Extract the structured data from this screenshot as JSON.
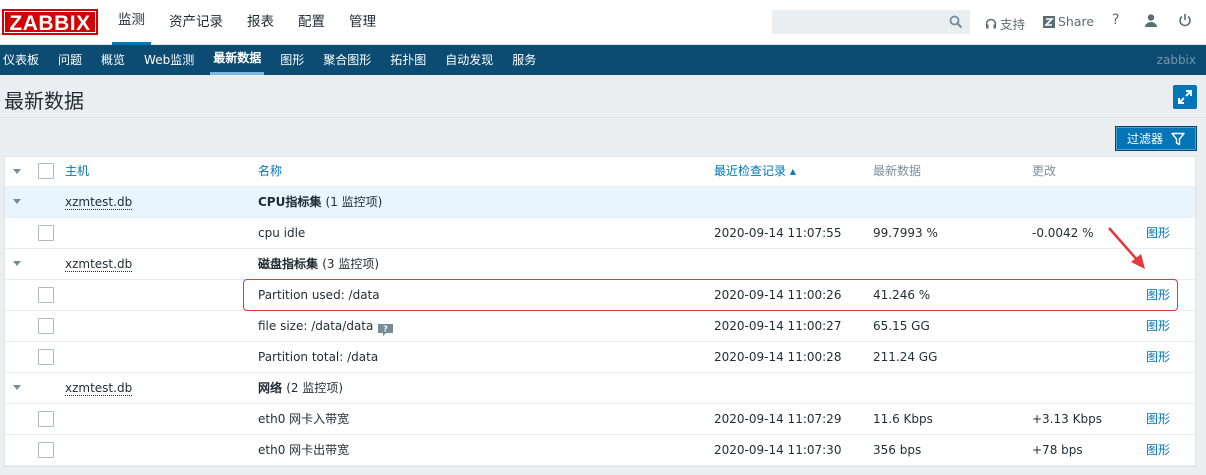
{
  "logo": "ZABBIX",
  "top_menu": [
    "监测",
    "资产记录",
    "报表",
    "配置",
    "管理"
  ],
  "top_menu_active": 0,
  "search": {
    "value": "",
    "placeholder": ""
  },
  "top_links": {
    "support": "支持",
    "share": "Share",
    "help": "?"
  },
  "sub_menu": [
    "仪表板",
    "问题",
    "概览",
    "Web监测",
    "最新数据",
    "图形",
    "聚合图形",
    "拓扑图",
    "自动发现",
    "服务"
  ],
  "sub_menu_active": 4,
  "user": "zabbix",
  "page_title": "最新数据",
  "filter_button": "过滤器",
  "table": {
    "headers": {
      "host": "主机",
      "name": "名称",
      "last_check": "最近检查记录 ▴",
      "last_value": "最新数据",
      "change": "更改"
    },
    "groups": [
      {
        "host": "xzmtest.db",
        "name": "CPU指标集",
        "count": "(1 监控项)",
        "items": [
          {
            "name": "cpu idle",
            "time": "2020-09-14 11:07:55",
            "value": "99.7993 %",
            "change": "-0.0042 %",
            "link": "图形",
            "hint": false
          }
        ]
      },
      {
        "host": "xzmtest.db",
        "name": "磁盘指标集",
        "count": "(3 监控项)",
        "items": [
          {
            "name": "Partition used: /data",
            "time": "2020-09-14 11:00:26",
            "value": "41.246 %",
            "change": "",
            "link": "图形",
            "hint": false
          },
          {
            "name": "file size: /data/data",
            "time": "2020-09-14 11:00:27",
            "value": "65.15 GG",
            "change": "",
            "link": "图形",
            "hint": true
          },
          {
            "name": "Partition total: /data",
            "time": "2020-09-14 11:00:28",
            "value": "211.24 GG",
            "change": "",
            "link": "图形",
            "hint": false
          }
        ]
      },
      {
        "host": "xzmtest.db",
        "name": "网络",
        "count": "(2 监控项)",
        "items": [
          {
            "name": "eth0 网卡入带宽",
            "time": "2020-09-14 11:07:29",
            "value": "11.6 Kbps",
            "change": "+3.13 Kbps",
            "link": "图形",
            "hint": false
          },
          {
            "name": "eth0 网卡出带宽",
            "time": "2020-09-14 11:07:30",
            "value": "356 bps",
            "change": "+78 bps",
            "link": "图形",
            "hint": false
          }
        ]
      }
    ]
  },
  "colors": {
    "accent": "#0275b8",
    "nav": "#0c4c72",
    "logo": "#d40000",
    "highlight": "#e3373a"
  }
}
